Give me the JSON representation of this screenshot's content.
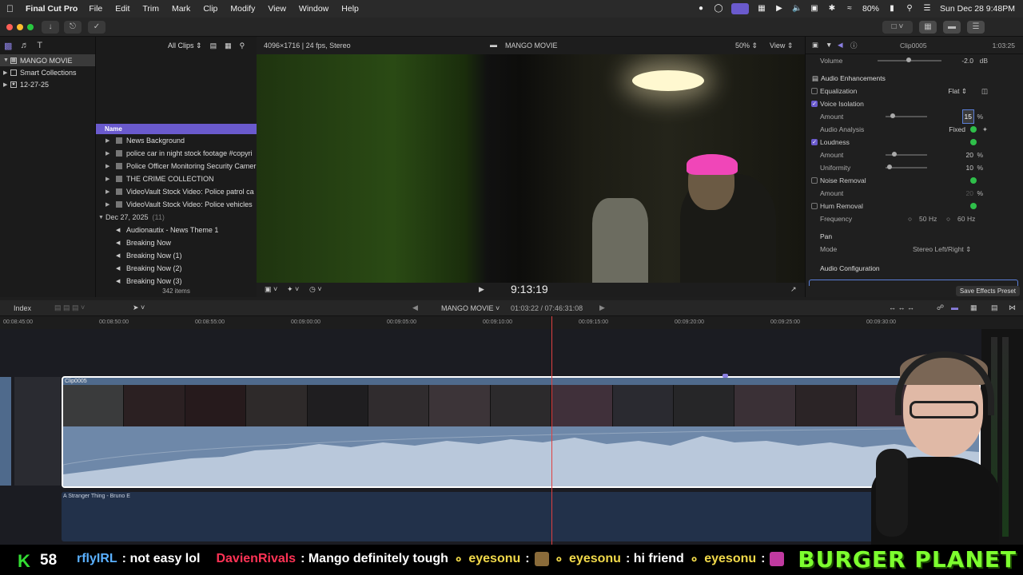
{
  "menubar": {
    "app_name": "Final Cut Pro",
    "items": [
      "File",
      "Edit",
      "Trim",
      "Mark",
      "Clip",
      "Modify",
      "View",
      "Window",
      "Help"
    ],
    "battery": "80%",
    "datetime": "Sun Dec 28  9:48PM"
  },
  "libraries": {
    "items": [
      {
        "label": "MANGO MOVIE",
        "selected": true
      },
      {
        "label": "Smart Collections"
      },
      {
        "label": "12-27-25"
      }
    ]
  },
  "browser": {
    "filter": "All Clips",
    "column_header": "Name",
    "rows": [
      {
        "label": "News Background",
        "kind": "folder"
      },
      {
        "label": "police  car in night stock footage #copyri",
        "kind": "video"
      },
      {
        "label": "Police Officer Monitoring Security Camer",
        "kind": "video"
      },
      {
        "label": "THE CRIME COLLECTION",
        "kind": "video"
      },
      {
        "label": "VideoVault Stock Video:   Police patrol ca",
        "kind": "video"
      },
      {
        "label": "VideoVault Stock Video:   Police vehicles",
        "kind": "video"
      }
    ],
    "group": {
      "label": "Dec 27, 2025",
      "count": "(11)"
    },
    "audio_rows": [
      "Audionautix - News Theme 1",
      "Breaking Now",
      "Breaking Now (1)",
      "Breaking Now (2)",
      "Breaking Now (3)"
    ],
    "item_count": "342 items"
  },
  "viewer": {
    "format": "4096×1716 | 24 fps, Stereo",
    "title": "MANGO MOVIE",
    "zoom": "50%",
    "view_menu": "View",
    "timecode": "9:13:19"
  },
  "inspector": {
    "clip_name": "Clip0005",
    "duration": "1:03:25",
    "volume_label": "Volume",
    "volume_value": "-2.0",
    "volume_unit": "dB",
    "enhancements_label": "Audio Enhancements",
    "equalization_label": "Equalization",
    "equalization_value": "Flat",
    "voice_isolation_label": "Voice Isolation",
    "voice_amount_label": "Amount",
    "voice_amount_value": "15",
    "analysis_label": "Audio Analysis",
    "analysis_value": "Fixed",
    "loudness_label": "Loudness",
    "loudness_amount_label": "Amount",
    "loudness_amount_value": "20",
    "uniformity_label": "Uniformity",
    "uniformity_value": "10",
    "noise_label": "Noise Removal",
    "noise_amount_label": "Amount",
    "noise_amount_value": "20",
    "hum_label": "Hum Removal",
    "frequency_label": "Frequency",
    "freq_50": "50",
    "freq_60": "60",
    "hz": "Hz",
    "pan_label": "Pan",
    "mode_label": "Mode",
    "mode_value": "Stereo Left/Right",
    "config_label": "Audio Configuration",
    "save_preset": "Save Effects Preset",
    "percent": "%"
  },
  "timeline": {
    "index_label": "Index",
    "project": "MANGO MOVIE",
    "position": "01:03:22 / 07:46:31:08",
    "ruler": [
      "00:08:45:00",
      "00:08:50:00",
      "00:08:55:00",
      "00:09:00:00",
      "00:09:05:00",
      "00:09:10:00",
      "00:09:15:00",
      "00:09:20:00",
      "00:09:25:00",
      "00:09:30:00"
    ],
    "clip_label": "Clip0005",
    "music_label": "A Stranger Thing - Bruno E"
  },
  "overlay": {
    "k_logo": "K",
    "viewer_count": "58",
    "chat": [
      {
        "user": "rflyIRL",
        "msg": ": not easy lol"
      },
      {
        "user": "DavienRivals",
        "msg": ": Mango definitely tough"
      },
      {
        "user": "eyesonu",
        "msg": ":"
      },
      {
        "user": "eyesonu",
        "msg": ": hi friend"
      },
      {
        "user": "eyesonu",
        "msg": ":"
      }
    ],
    "brand": "BURGER PLANET"
  },
  "colors": {
    "accent": "#6a5acd",
    "playhead": "#e04040",
    "ok_green": "#2fbf4a",
    "clip_blue": "#4f6a8c",
    "brand_green": "#7dff2f"
  }
}
